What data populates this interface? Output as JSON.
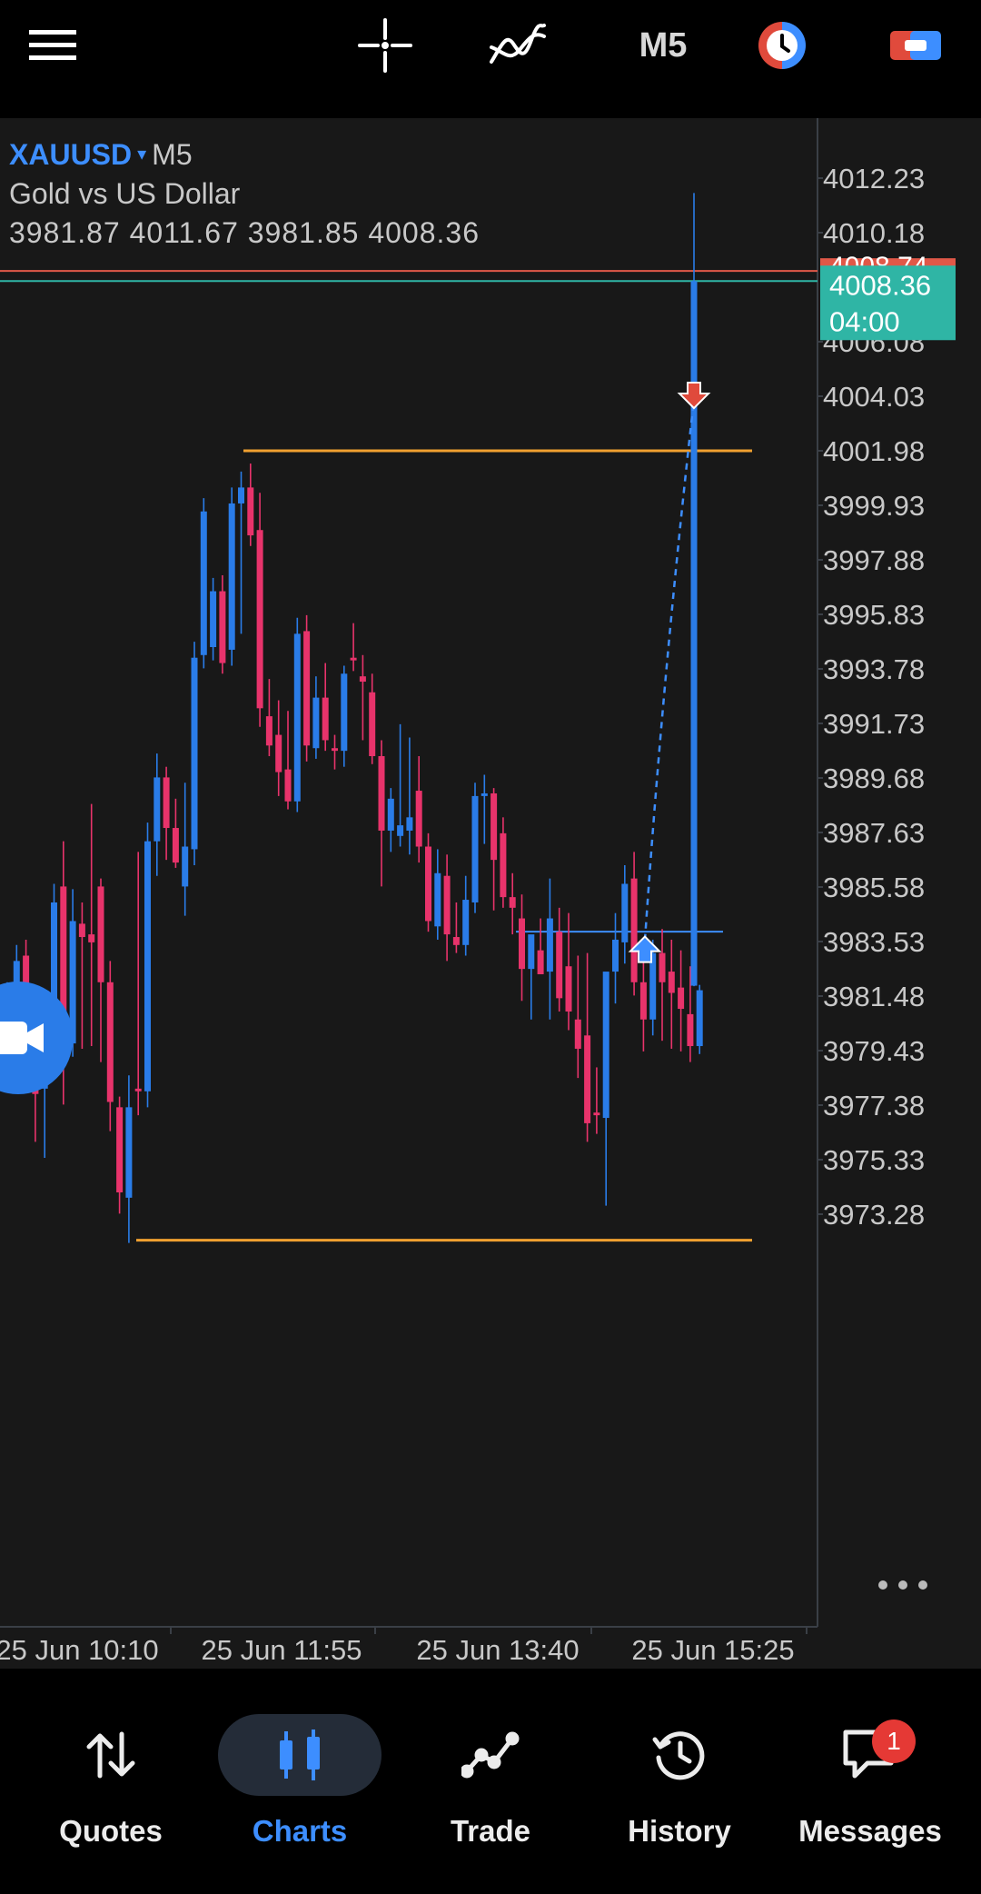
{
  "topbar": {
    "menu_icon": "hamburger-menu-icon",
    "crosshair_icon": "crosshair-icon",
    "indicators_icon": "indicators-icon",
    "timeframe": "M5",
    "one_click_icon": "one-click-trading-icon",
    "trade_icon": "trade-toggle-icon"
  },
  "chart": {
    "symbol": "XAUUSD",
    "symbol_arrow": "▾",
    "timeframe": "M5",
    "description": "Gold vs US Dollar",
    "ohlc": "3981.87 4011.67 3981.85 4008.36",
    "bid_price": "4008.36",
    "countdown": "04:00",
    "ask_price": "4008.74",
    "more_icon": "more-dots-icon",
    "camera_icon": "video-call-icon",
    "colors": {
      "bull": "#2a7ce8",
      "bear": "#e8336b",
      "bg": "#181818",
      "ask_line": "#e05848",
      "bid_line": "#2fb5a5",
      "level": "#f0a030"
    }
  },
  "chart_data": {
    "type": "candlestick",
    "symbol": "XAUUSD",
    "timeframe": "M5",
    "price_ticks": [
      "4012.23",
      "4010.18",
      "4006.08",
      "4004.03",
      "4001.98",
      "3999.93",
      "3997.88",
      "3995.83",
      "3993.78",
      "3991.73",
      "3989.68",
      "3987.63",
      "3985.58",
      "3983.53",
      "3981.48",
      "3979.43",
      "3977.38",
      "3975.33",
      "3973.28"
    ],
    "time_ticks": [
      "25 Jun 10:10",
      "25 Jun 11:55",
      "25 Jun 13:40",
      "25 Jun 15:25"
    ],
    "ylim": [
      3971.3,
      4014.6
    ],
    "current": {
      "open": 3981.87,
      "high": 4011.67,
      "low": 3981.85,
      "close": 4008.36
    },
    "bid": 4008.36,
    "ask": 4008.74,
    "levels": [
      4001.98,
      3972.3,
      3983.9
    ],
    "trade_entry": {
      "side": "buy",
      "price": 3983.1
    },
    "trade_exit": {
      "side": "sell",
      "price": 4004.2
    },
    "candles": [
      {
        "o": 3980.0,
        "h": 3982.0,
        "l": 3978.5,
        "c": 3981.6
      },
      {
        "o": 3979.5,
        "h": 3983.4,
        "l": 3978.2,
        "c": 3982.8
      },
      {
        "o": 3983.0,
        "h": 3983.6,
        "l": 3978.6,
        "c": 3979.3
      },
      {
        "o": 3978.6,
        "h": 3980.5,
        "l": 3976.0,
        "c": 3977.8
      },
      {
        "o": 3978.0,
        "h": 3980.5,
        "l": 3975.4,
        "c": 3979.6
      },
      {
        "o": 3979.4,
        "h": 3985.7,
        "l": 3979.0,
        "c": 3985.0
      },
      {
        "o": 3985.6,
        "h": 3987.3,
        "l": 3977.4,
        "c": 3979.7
      },
      {
        "o": 3979.7,
        "h": 3985.5,
        "l": 3979.2,
        "c": 3984.3
      },
      {
        "o": 3984.2,
        "h": 3985.0,
        "l": 3979.5,
        "c": 3983.7
      },
      {
        "o": 3983.8,
        "h": 3988.7,
        "l": 3979.6,
        "c": 3983.5
      },
      {
        "o": 3985.6,
        "h": 3985.9,
        "l": 3979.0,
        "c": 3982.0
      },
      {
        "o": 3982.0,
        "h": 3982.8,
        "l": 3976.4,
        "c": 3977.5
      },
      {
        "o": 3977.3,
        "h": 3977.7,
        "l": 3973.3,
        "c": 3974.1
      },
      {
        "o": 3973.9,
        "h": 3978.5,
        "l": 3972.2,
        "c": 3977.3
      },
      {
        "o": 3978.0,
        "h": 3986.9,
        "l": 3977.0,
        "c": 3977.9
      },
      {
        "o": 3977.9,
        "h": 3988.0,
        "l": 3977.3,
        "c": 3987.3
      },
      {
        "o": 3987.3,
        "h": 3990.6,
        "l": 3986.0,
        "c": 3989.7
      },
      {
        "o": 3989.7,
        "h": 3990.1,
        "l": 3986.6,
        "c": 3987.8
      },
      {
        "o": 3987.8,
        "h": 3988.9,
        "l": 3986.3,
        "c": 3986.5
      },
      {
        "o": 3985.6,
        "h": 3989.5,
        "l": 3984.5,
        "c": 3987.1
      },
      {
        "o": 3987.0,
        "h": 3994.8,
        "l": 3986.4,
        "c": 3994.2
      },
      {
        "o": 3994.3,
        "h": 4000.2,
        "l": 3993.8,
        "c": 3999.7
      },
      {
        "o": 3994.6,
        "h": 3997.2,
        "l": 3994.1,
        "c": 3996.7
      },
      {
        "o": 3996.7,
        "h": 3997.3,
        "l": 3993.6,
        "c": 3994.0
      },
      {
        "o": 3994.5,
        "h": 4000.6,
        "l": 3993.9,
        "c": 4000.0
      },
      {
        "o": 4000.0,
        "h": 4001.2,
        "l": 3995.1,
        "c": 4000.6
      },
      {
        "o": 4000.6,
        "h": 4001.5,
        "l": 3998.4,
        "c": 3998.8
      },
      {
        "o": 3999.0,
        "h": 4000.4,
        "l": 3991.6,
        "c": 3992.3
      },
      {
        "o": 3992.0,
        "h": 3993.4,
        "l": 3990.5,
        "c": 3990.9
      },
      {
        "o": 3991.3,
        "h": 3992.6,
        "l": 3989.0,
        "c": 3989.9
      },
      {
        "o": 3990.0,
        "h": 3992.2,
        "l": 3988.5,
        "c": 3988.8
      },
      {
        "o": 3988.8,
        "h": 3995.7,
        "l": 3988.4,
        "c": 3995.1
      },
      {
        "o": 3995.2,
        "h": 3995.8,
        "l": 3990.3,
        "c": 3990.9
      },
      {
        "o": 3990.8,
        "h": 3993.5,
        "l": 3990.4,
        "c": 3992.7
      },
      {
        "o": 3992.7,
        "h": 3994.0,
        "l": 3990.7,
        "c": 3991.1
      },
      {
        "o": 3990.8,
        "h": 3991.3,
        "l": 3990.0,
        "c": 3990.7
      },
      {
        "o": 3990.7,
        "h": 3993.9,
        "l": 3990.1,
        "c": 3993.6
      },
      {
        "o": 3994.2,
        "h": 3995.5,
        "l": 3993.7,
        "c": 3994.1
      },
      {
        "o": 3993.5,
        "h": 3994.3,
        "l": 3991.1,
        "c": 3993.3
      },
      {
        "o": 3992.9,
        "h": 3993.6,
        "l": 3990.2,
        "c": 3990.5
      },
      {
        "o": 3990.5,
        "h": 3991.1,
        "l": 3985.6,
        "c": 3987.7
      },
      {
        "o": 3987.7,
        "h": 3989.3,
        "l": 3986.9,
        "c": 3988.9
      },
      {
        "o": 3987.5,
        "h": 3991.7,
        "l": 3987.1,
        "c": 3987.9
      },
      {
        "o": 3987.7,
        "h": 3991.2,
        "l": 3986.8,
        "c": 3988.2
      },
      {
        "o": 3989.2,
        "h": 3990.5,
        "l": 3986.5,
        "c": 3987.1
      },
      {
        "o": 3987.1,
        "h": 3987.6,
        "l": 3983.9,
        "c": 3984.3
      },
      {
        "o": 3984.1,
        "h": 3987.0,
        "l": 3983.6,
        "c": 3986.1
      },
      {
        "o": 3986.0,
        "h": 3986.8,
        "l": 3982.8,
        "c": 3983.8
      },
      {
        "o": 3983.7,
        "h": 3985.0,
        "l": 3983.1,
        "c": 3983.4
      },
      {
        "o": 3983.4,
        "h": 3986.0,
        "l": 3983.0,
        "c": 3985.1
      },
      {
        "o": 3985.0,
        "h": 3989.5,
        "l": 3984.6,
        "c": 3989.0
      },
      {
        "o": 3989.0,
        "h": 3989.8,
        "l": 3987.2,
        "c": 3989.1
      },
      {
        "o": 3989.1,
        "h": 3989.3,
        "l": 3984.7,
        "c": 3986.6
      },
      {
        "o": 3987.6,
        "h": 3988.2,
        "l": 3984.8,
        "c": 3985.2
      },
      {
        "o": 3985.2,
        "h": 3986.1,
        "l": 3983.8,
        "c": 3984.8
      },
      {
        "o": 3984.4,
        "h": 3985.3,
        "l": 3981.3,
        "c": 3982.5
      },
      {
        "o": 3982.5,
        "h": 3983.6,
        "l": 3980.6,
        "c": 3983.8
      },
      {
        "o": 3983.2,
        "h": 3984.4,
        "l": 3982.7,
        "c": 3982.3
      },
      {
        "o": 3982.4,
        "h": 3985.9,
        "l": 3980.6,
        "c": 3984.4
      },
      {
        "o": 3983.9,
        "h": 3984.8,
        "l": 3980.9,
        "c": 3981.4
      },
      {
        "o": 3982.6,
        "h": 3984.6,
        "l": 3980.2,
        "c": 3980.9
      },
      {
        "o": 3980.6,
        "h": 3983.0,
        "l": 3978.4,
        "c": 3979.5
      },
      {
        "o": 3980.0,
        "h": 3983.1,
        "l": 3976.0,
        "c": 3976.7
      },
      {
        "o": 3977.1,
        "h": 3978.8,
        "l": 3976.3,
        "c": 3977.0
      },
      {
        "o": 3976.9,
        "h": 3982.1,
        "l": 3973.6,
        "c": 3982.4
      },
      {
        "o": 3982.4,
        "h": 3984.6,
        "l": 3981.2,
        "c": 3983.6
      },
      {
        "o": 3983.5,
        "h": 3986.4,
        "l": 3982.7,
        "c": 3985.7
      },
      {
        "o": 3985.9,
        "h": 3986.9,
        "l": 3981.5,
        "c": 3982.0
      },
      {
        "o": 3982.0,
        "h": 3982.8,
        "l": 3979.4,
        "c": 3980.6
      },
      {
        "o": 3980.6,
        "h": 3983.6,
        "l": 3980.0,
        "c": 3983.1
      },
      {
        "o": 3983.1,
        "h": 3984.0,
        "l": 3979.8,
        "c": 3982.0
      },
      {
        "o": 3982.4,
        "h": 3983.6,
        "l": 3979.5,
        "c": 3981.6
      },
      {
        "o": 3981.8,
        "h": 3983.2,
        "l": 3979.4,
        "c": 3981.0
      },
      {
        "o": 3980.8,
        "h": 3982.6,
        "l": 3979.0,
        "c": 3979.6
      },
      {
        "o": 3979.6,
        "h": 3981.9,
        "l": 3979.3,
        "c": 3981.7
      },
      {
        "o": 3981.87,
        "h": 4011.67,
        "l": 3981.85,
        "c": 4008.36
      }
    ]
  },
  "nav": [
    {
      "label": "Quotes",
      "icon": "quotes-arrows-icon",
      "active": false
    },
    {
      "label": "Charts",
      "icon": "charts-candles-icon",
      "active": true
    },
    {
      "label": "Trade",
      "icon": "trade-line-icon",
      "active": false
    },
    {
      "label": "History",
      "icon": "history-clock-icon",
      "active": false
    },
    {
      "label": "Messages",
      "icon": "messages-chat-icon",
      "active": false
    }
  ],
  "messages_badge": "1"
}
